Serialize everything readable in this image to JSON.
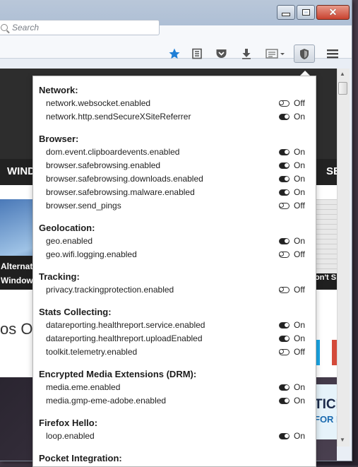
{
  "toolbar": {
    "search_placeholder": "Search"
  },
  "page": {
    "nav_left": "WINDO",
    "nav_right": "SE",
    "thumb_left_caption_1": "Alternat",
    "thumb_left_caption_2": "Window",
    "thumb_right_caption": "on't S",
    "headline_partial": "os O",
    "ad_line_1": "TICL",
    "ad_line_2": "FOR FI"
  },
  "popup": {
    "groups": [
      {
        "title": "Network:",
        "prefs": [
          {
            "name": "network.websocket.enabled",
            "state": "Off"
          },
          {
            "name": "network.http.sendSecureXSiteReferrer",
            "state": "On"
          }
        ]
      },
      {
        "title": "Browser:",
        "prefs": [
          {
            "name": "dom.event.clipboardevents.enabled",
            "state": "On"
          },
          {
            "name": "browser.safebrowsing.enabled",
            "state": "On"
          },
          {
            "name": "browser.safebrowsing.downloads.enabled",
            "state": "On"
          },
          {
            "name": "browser.safebrowsing.malware.enabled",
            "state": "On"
          },
          {
            "name": "browser.send_pings",
            "state": "Off"
          }
        ]
      },
      {
        "title": "Geolocation:",
        "prefs": [
          {
            "name": "geo.enabled",
            "state": "On"
          },
          {
            "name": "geo.wifi.logging.enabled",
            "state": "Off"
          }
        ]
      },
      {
        "title": "Tracking:",
        "prefs": [
          {
            "name": "privacy.trackingprotection.enabled",
            "state": "Off"
          }
        ]
      },
      {
        "title": "Stats Collecting:",
        "prefs": [
          {
            "name": "datareporting.healthreport.service.enabled",
            "state": "On"
          },
          {
            "name": "datareporting.healthreport.uploadEnabled",
            "state": "On"
          },
          {
            "name": "toolkit.telemetry.enabled",
            "state": "Off"
          }
        ]
      },
      {
        "title": "Encrypted Media Extensions (DRM):",
        "prefs": [
          {
            "name": "media.eme.enabled",
            "state": "On"
          },
          {
            "name": "media.gmp-eme-adobe.enabled",
            "state": "On"
          }
        ]
      },
      {
        "title": "Firefox Hello:",
        "prefs": [
          {
            "name": "loop.enabled",
            "state": "On"
          }
        ]
      },
      {
        "title": "Pocket Integration:",
        "prefs": []
      }
    ]
  },
  "colors": {
    "bookmark_star": "#1f7fd6",
    "close_button": "#c9422f"
  }
}
